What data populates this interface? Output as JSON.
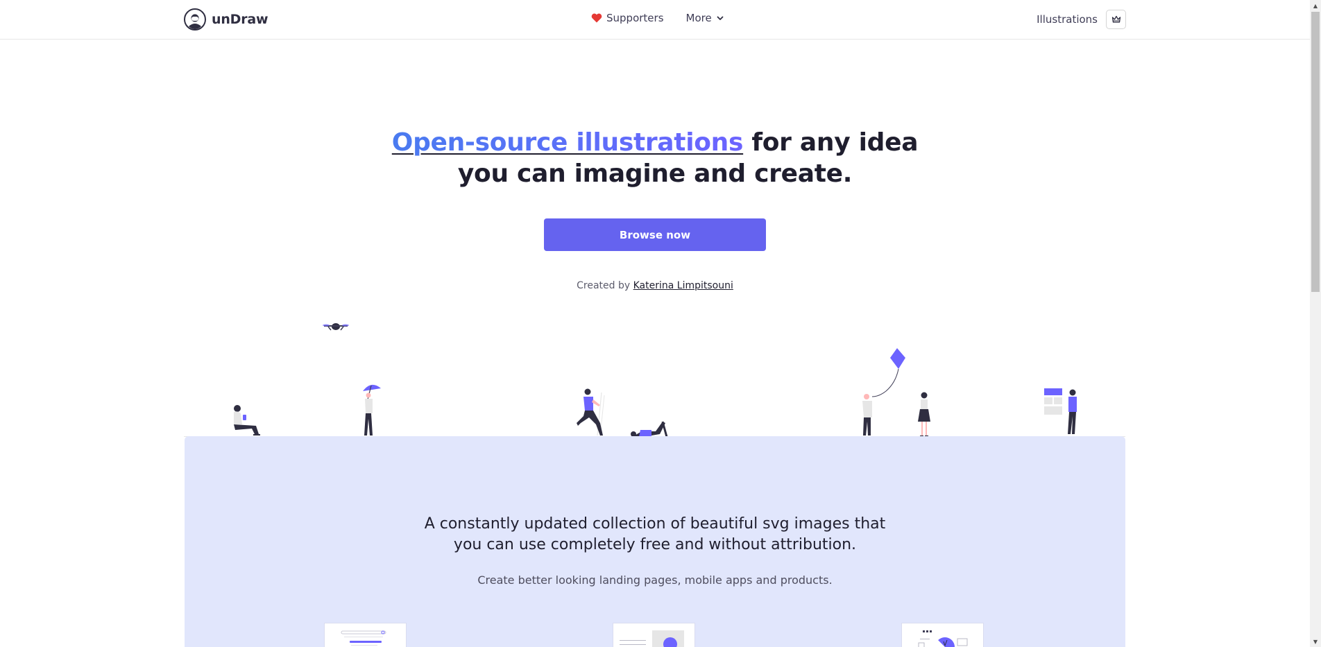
{
  "header": {
    "logo_text": "unDraw",
    "nav": {
      "supporters_label": "Supporters",
      "more_label": "More"
    },
    "illustrations_label": "Illustrations"
  },
  "hero": {
    "title_accent": "Open-source illustrations",
    "title_rest_line1": " for any idea",
    "title_line2": "you can imagine and create.",
    "cta_label": "Browse now",
    "created_by_prefix": "Created by ",
    "author_name": "Katerina Limpitsouni"
  },
  "panel": {
    "title_line1": "A constantly updated collection of beautiful svg images that",
    "title_line2": "you can use completely free and without attribution.",
    "subtitle": "Create better looking landing pages, mobile apps and products."
  },
  "colors": {
    "accent": "#6c63ff",
    "button": "#6563ef",
    "panel_bg": "#e1e6fc",
    "ink": "#2f2e41",
    "heart": "#e53935"
  },
  "icons": {
    "logo": "undraw-logo-icon",
    "heart": "heart-icon",
    "more": "chevron-down-icon",
    "shop": "crown-icon"
  }
}
